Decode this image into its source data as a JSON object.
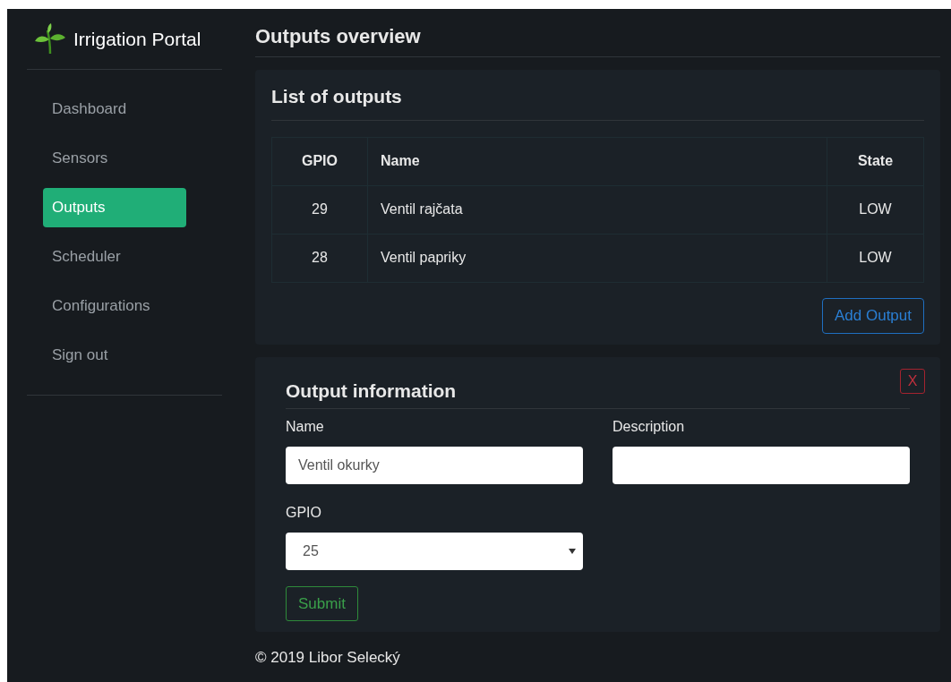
{
  "brand": {
    "title": "Irrigation Portal"
  },
  "sidebar": {
    "items": [
      {
        "label": "Dashboard",
        "selected": false
      },
      {
        "label": "Sensors",
        "selected": false
      },
      {
        "label": "Outputs",
        "selected": true
      },
      {
        "label": "Scheduler",
        "selected": false
      },
      {
        "label": "Configurations",
        "selected": false
      },
      {
        "label": "Sign out",
        "selected": false
      }
    ]
  },
  "page_title": "Outputs overview",
  "outputs_card": {
    "title": "List of outputs",
    "table": {
      "columns": [
        "GPIO",
        "Name",
        "State"
      ],
      "rows": [
        [
          "29",
          "Ventil rajčata",
          "LOW"
        ],
        [
          "28",
          "Ventil papriky",
          "LOW"
        ]
      ]
    },
    "add_button": "Add Output"
  },
  "form_card": {
    "title": "Output information",
    "close": "X",
    "name": {
      "label": "Name",
      "value": "Ventil okurky"
    },
    "description": {
      "label": "Description"
    },
    "gpio": {
      "label": "GPIO",
      "value": "25"
    },
    "submit": "Submit"
  },
  "footer": "© 2019 Libor Selecký"
}
